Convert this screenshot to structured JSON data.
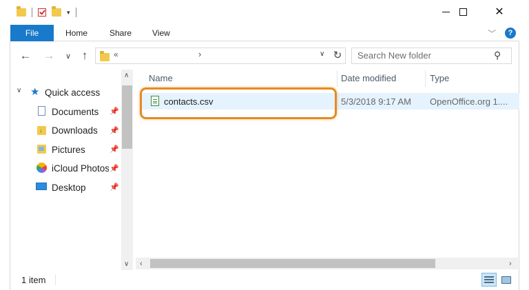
{
  "window": {
    "qat_dropdown": "▾",
    "minimize_label": "",
    "close_glyph": "✕"
  },
  "ribbon": {
    "tabs": [
      "File",
      "Home",
      "Share",
      "View"
    ],
    "collapse_glyph": "﹀",
    "help_label": "?"
  },
  "address_bar": {
    "path_prefix": "«",
    "path_chevron": "›",
    "dropdown_glyph": "∨",
    "refresh_glyph": "↻"
  },
  "nav_buttons": {
    "back": "←",
    "forward": "→",
    "recent": "∨",
    "up": "↑"
  },
  "search": {
    "placeholder": "Search New folder",
    "icon_glyph": "⚲"
  },
  "nav_pane": {
    "quick_access": "Quick access",
    "items": [
      {
        "label": "Documents",
        "icon": "documents-icon",
        "pinned": true
      },
      {
        "label": "Downloads",
        "icon": "downloads-icon",
        "pinned": true
      },
      {
        "label": "Pictures",
        "icon": "pictures-icon",
        "pinned": true
      },
      {
        "label": "iCloud Photos",
        "icon": "icloud-photos-icon",
        "pinned": true
      },
      {
        "label": "Desktop",
        "icon": "desktop-icon",
        "pinned": true
      }
    ]
  },
  "file_list": {
    "columns": [
      "Name",
      "Date modified",
      "Type"
    ],
    "rows": [
      {
        "name": "contacts.csv",
        "date_modified": "5/3/2018 9:17 AM",
        "type": "OpenOffice.org 1...."
      }
    ]
  },
  "status_bar": {
    "item_count": "1 item"
  },
  "colors": {
    "accent": "#1979ca",
    "selection": "#e5f3ff",
    "highlight_outline": "#e68a1f"
  }
}
